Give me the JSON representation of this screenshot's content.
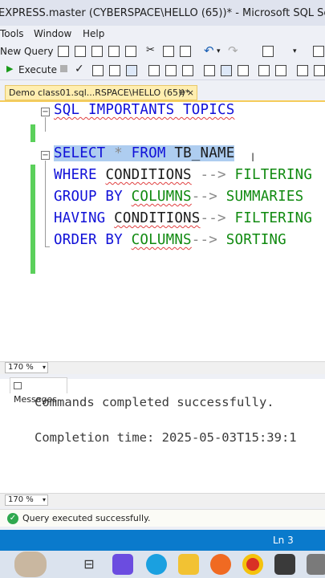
{
  "window": {
    "title": "EXPRESS.master (CYBERSPACE\\HELLO (65))* - Microsoft SQL Server Management S"
  },
  "menu": {
    "items": [
      "Tools",
      "Window",
      "Help"
    ]
  },
  "toolbar": {
    "new_query": "New Query",
    "execute": "Execute"
  },
  "tab": {
    "title": "Demo class01.sql...RSPACE\\HELLO (65))*",
    "pin": "⊕",
    "close": "×"
  },
  "editor": {
    "comment": "SQL IMPORTANTS TOPICS",
    "lines": [
      {
        "kw": "SELECT",
        "mid": " * ",
        "kw2": "FROM",
        "rest": " TB_NAME"
      },
      {
        "kw": "WHERE",
        "ident": "CONDITIONS",
        "arrow": " --> ",
        "note": "FILTERING"
      },
      {
        "kw": "GROUP BY",
        "ident": "COLUMNS",
        "arrow": "--> ",
        "note": "SUMMARIES"
      },
      {
        "kw": "HAVING",
        "ident": "CONDITIONS",
        "arrow": "--> ",
        "note": "FILTERING"
      },
      {
        "kw": "ORDER BY",
        "ident": "COLUMNS",
        "arrow": "--> ",
        "note": "SORTING"
      }
    ]
  },
  "zoom": {
    "editor": "170 %",
    "results": "170 %"
  },
  "messages": {
    "tab_label": "Messages",
    "line1": "Commands completed successfully.",
    "line2": "Completion time: 2025-05-03T15:39:1"
  },
  "status": {
    "query_status": "Query executed successfully.",
    "line": "Ln 3"
  },
  "colors": {
    "accent": "#0a7acc",
    "keyword": "#1010d8",
    "comment_green": "#108a10",
    "selection": "#aecdf0",
    "tab_active": "#ffeeb0"
  }
}
